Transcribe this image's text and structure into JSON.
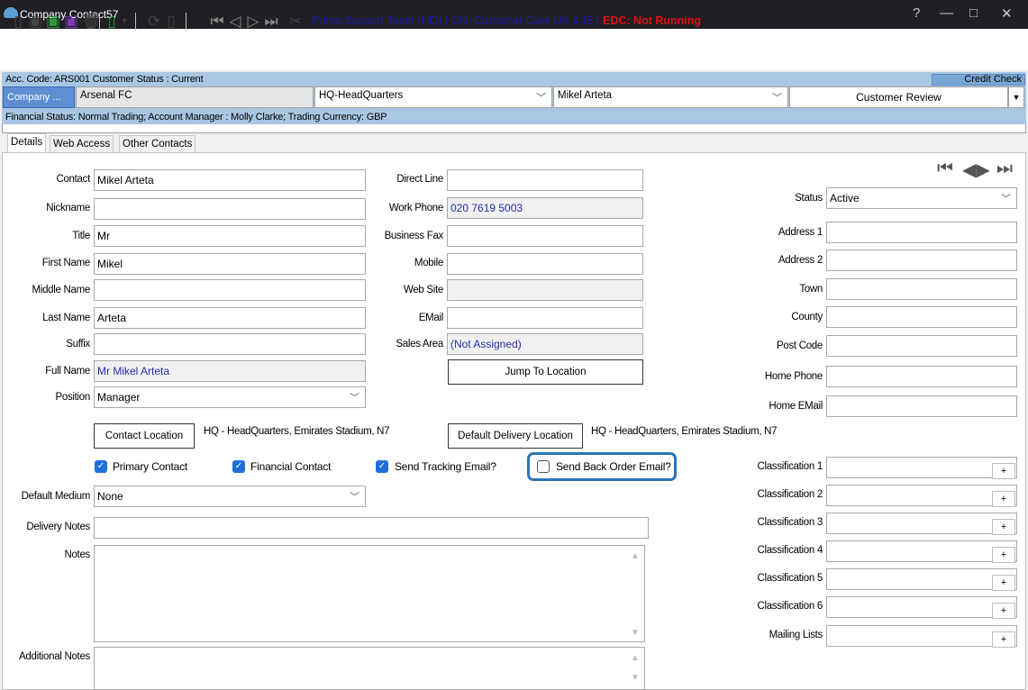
{
  "window": {
    "title": "Company Contact57",
    "help": "?",
    "minimize": "—",
    "maximize": "□",
    "close": "✕"
  },
  "toolbar": {
    "status_text": "Prima Support Team (HQ) | ON: Customer Care UK & IE |",
    "edc_text": "EDC: Not Running"
  },
  "account": {
    "line1": "Acc. Code: ARS001  Customer Status : Current",
    "credit_check": "Credit Check",
    "company_button": "Company ...",
    "company_value": "Arsenal FC",
    "location_value": "HQ-HeadQuarters",
    "contact_value": "Mikel Arteta",
    "review_button": "Customer Review",
    "line3": "Financial Status: Normal Trading;  Account Manager : Molly Clarke; Trading Currency: GBP"
  },
  "tabs": [
    {
      "label": "Details"
    },
    {
      "label": "Web Access"
    },
    {
      "label": "Other Contacts"
    }
  ],
  "left": {
    "contact_label": "Contact",
    "contact_value": "Mikel Arteta",
    "nickname_label": "Nickname",
    "nickname_value": "",
    "title_label": "Title",
    "title_value": "Mr",
    "first_label": "First Name",
    "first_value": "Mikel",
    "middle_label": "Middle Name",
    "middle_value": "",
    "last_label": "Last Name",
    "last_value": "Arteta",
    "suffix_label": "Suffix",
    "suffix_value": "",
    "full_label": "Full Name",
    "full_value": "Mr Mikel Arteta",
    "position_label": "Position",
    "position_value": "Manager",
    "contact_location_button": "Contact Location",
    "contact_location_text": "HQ - HeadQuarters, Emirates Stadium, N7",
    "default_medium_label": "Default Medium",
    "default_medium_value": "None",
    "delivery_notes_label": "Delivery Notes",
    "delivery_notes_value": "",
    "notes_label": "Notes",
    "notes_value": "",
    "additional_notes_label": "Additional Notes",
    "additional_notes_value": ""
  },
  "middle": {
    "direct_label": "Direct Line",
    "direct_value": "",
    "work_label": "Work Phone",
    "work_value": "020 7619 5003",
    "fax_label": "Business Fax",
    "fax_value": "",
    "mobile_label": "Mobile",
    "mobile_value": "",
    "web_label": "Web Site",
    "web_value": "",
    "email_label": "EMail",
    "email_value": "",
    "sales_label": "Sales Area",
    "sales_value": "(Not Assigned)",
    "jump_button": "Jump To Location",
    "default_delivery_button": "Default Delivery Location",
    "default_delivery_text": "HQ - HeadQuarters, Emirates Stadium, N7"
  },
  "checks": {
    "primary": {
      "label": "Primary Contact",
      "checked": true
    },
    "financial": {
      "label": "Financial Contact",
      "checked": true
    },
    "tracking": {
      "label": "Send Tracking Email?",
      "checked": true
    },
    "backorder": {
      "label": "Send Back Order Email?",
      "checked": false
    }
  },
  "right": {
    "status_label": "Status",
    "status_value": "Active",
    "address1_label": "Address 1",
    "address1_value": "",
    "address2_label": "Address 2",
    "address2_value": "",
    "town_label": "Town",
    "town_value": "",
    "county_label": "County",
    "county_value": "",
    "postcode_label": "Post Code",
    "postcode_value": "",
    "homephone_label": "Home Phone",
    "homephone_value": "",
    "homeemail_label": "Home EMail",
    "homeemail_value": "",
    "class1_label": "Classification 1",
    "class2_label": "Classification 2",
    "class3_label": "Classification 3",
    "class4_label": "Classification 4",
    "class5_label": "Classification 5",
    "class6_label": "Classification 6",
    "mailing_label": "Mailing Lists",
    "plus": "+"
  },
  "colors": {
    "titlebar": "#1f1f24",
    "band": "#a9c7e3",
    "accent": "#1f6fd6",
    "edc": "#e01010",
    "highlight": "#2a73b8"
  }
}
